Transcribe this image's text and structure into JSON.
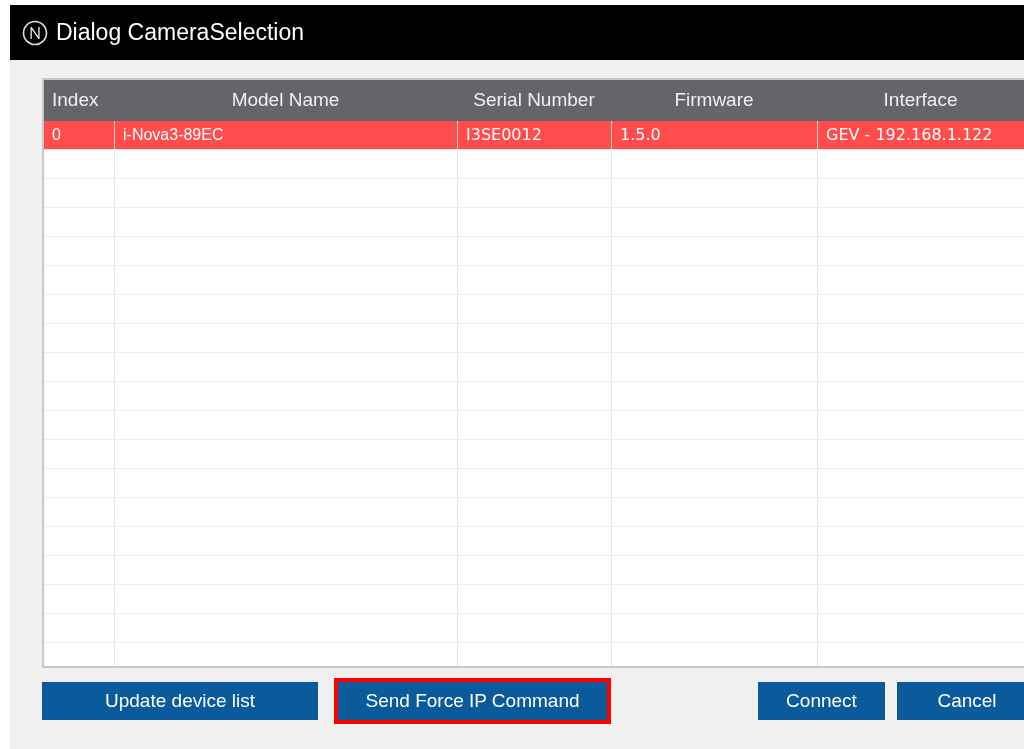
{
  "window": {
    "title": "Dialog CameraSelection"
  },
  "table": {
    "columns": [
      "Index",
      "Model Name",
      "Serial Number",
      "Firmware",
      "Interface"
    ],
    "rows": [
      {
        "cells": [
          "0",
          "i-Nova3-89EC",
          "I3SE0012",
          "1.5.0",
          "GEV - 192.168.1.122"
        ],
        "selected": true
      }
    ]
  },
  "buttons": [
    {
      "label": "Update device list",
      "highlighted": false
    },
    {
      "label": "Send Force IP Command",
      "highlighted": true
    },
    {
      "label": "Connect",
      "highlighted": false
    },
    {
      "label": "Cancel",
      "highlighted": false
    }
  ]
}
